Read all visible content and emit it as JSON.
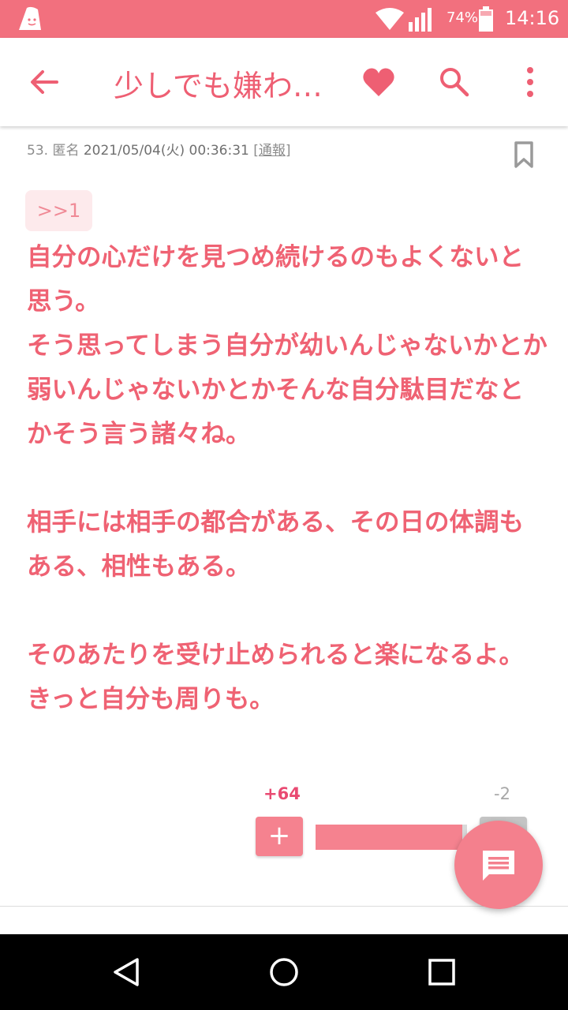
{
  "status_bar": {
    "battery_percent": "74%",
    "time": "14:16"
  },
  "header": {
    "title": "少しでも嫌わ…"
  },
  "post": {
    "number": "53.",
    "author": "匿名",
    "datetime": "2021/05/04(火) 00:36:31",
    "report_label": "通報",
    "reply_anchor": ">>1",
    "body": "自分の心だけを見つめ続けるのもよくないと思う。\nそう思ってしまう自分が幼いんじゃないかとか弱いんじゃないかとかそんな自分駄目だなとかそう言う諸々ね。\n\n相手には相手の都合がある、その日の体調もある、相性もある。\n\nそのあたりを受け止められると楽になるよ。\nきっと自分も周りも。",
    "votes": {
      "plus": "+64",
      "minus": "-2",
      "plus_label": "+",
      "ratio": 0.97
    }
  },
  "colors": {
    "accent": "#f2707e",
    "text_pink": "#ef6273"
  }
}
